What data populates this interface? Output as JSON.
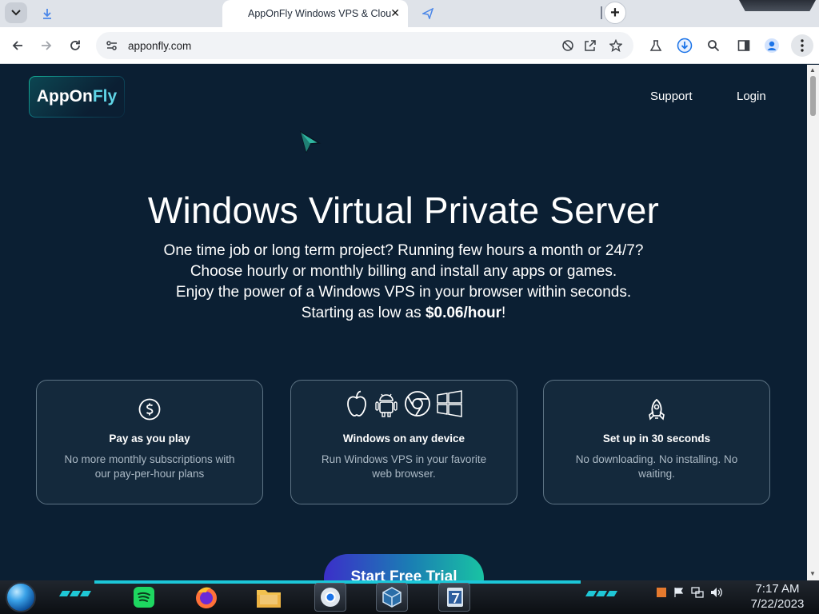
{
  "browser": {
    "tabs": [
      {
        "label": "",
        "active": false
      },
      {
        "label": "AppOnFly Windows VPS & Clou",
        "active": true
      },
      {
        "label": "",
        "active": false
      }
    ],
    "new_tab_symbol": "+",
    "close_symbol": "✕",
    "url": "apponfly.com"
  },
  "site": {
    "logo": {
      "part1": "AppOn",
      "part2": "Fly"
    },
    "nav": [
      {
        "label": "Support"
      },
      {
        "label": "Login"
      }
    ],
    "hero": {
      "title": "Windows Virtual Private Server",
      "line1": "One time job or long term project? Running few hours a month or 24/7?",
      "line2": "Choose hourly or monthly billing and install any apps or games.",
      "line3": "Enjoy the power of a Windows VPS in your browser within seconds.",
      "line4_prefix": "Starting as low as ",
      "line4_price": "$0.06/hour",
      "line4_suffix": "!"
    },
    "features": [
      {
        "icon": "dollar-circle-icon",
        "title": "Pay as you play",
        "desc": "No more monthly subscriptions with our pay-per-hour plans"
      },
      {
        "icon": "device-platforms-icons",
        "title": "Windows on any device",
        "desc": "Run Windows VPS in your favorite web browser."
      },
      {
        "icon": "rocket-icon",
        "title": "Set up in 30 seconds",
        "desc": "No downloading. No installing. No waiting."
      }
    ],
    "cta_label": "Start Free Trial",
    "colors": {
      "background": "#0b1f33",
      "card": "#14293c",
      "accent": "#19c3a3"
    }
  },
  "taskbar": {
    "apps": [
      "spotify-icon",
      "firefox-icon",
      "file-explorer-icon",
      "chrome-icon",
      "virtualbox-icon",
      "windows7-usb-icon"
    ],
    "clock_time": "7:17 AM",
    "clock_date": "7/22/2023"
  }
}
